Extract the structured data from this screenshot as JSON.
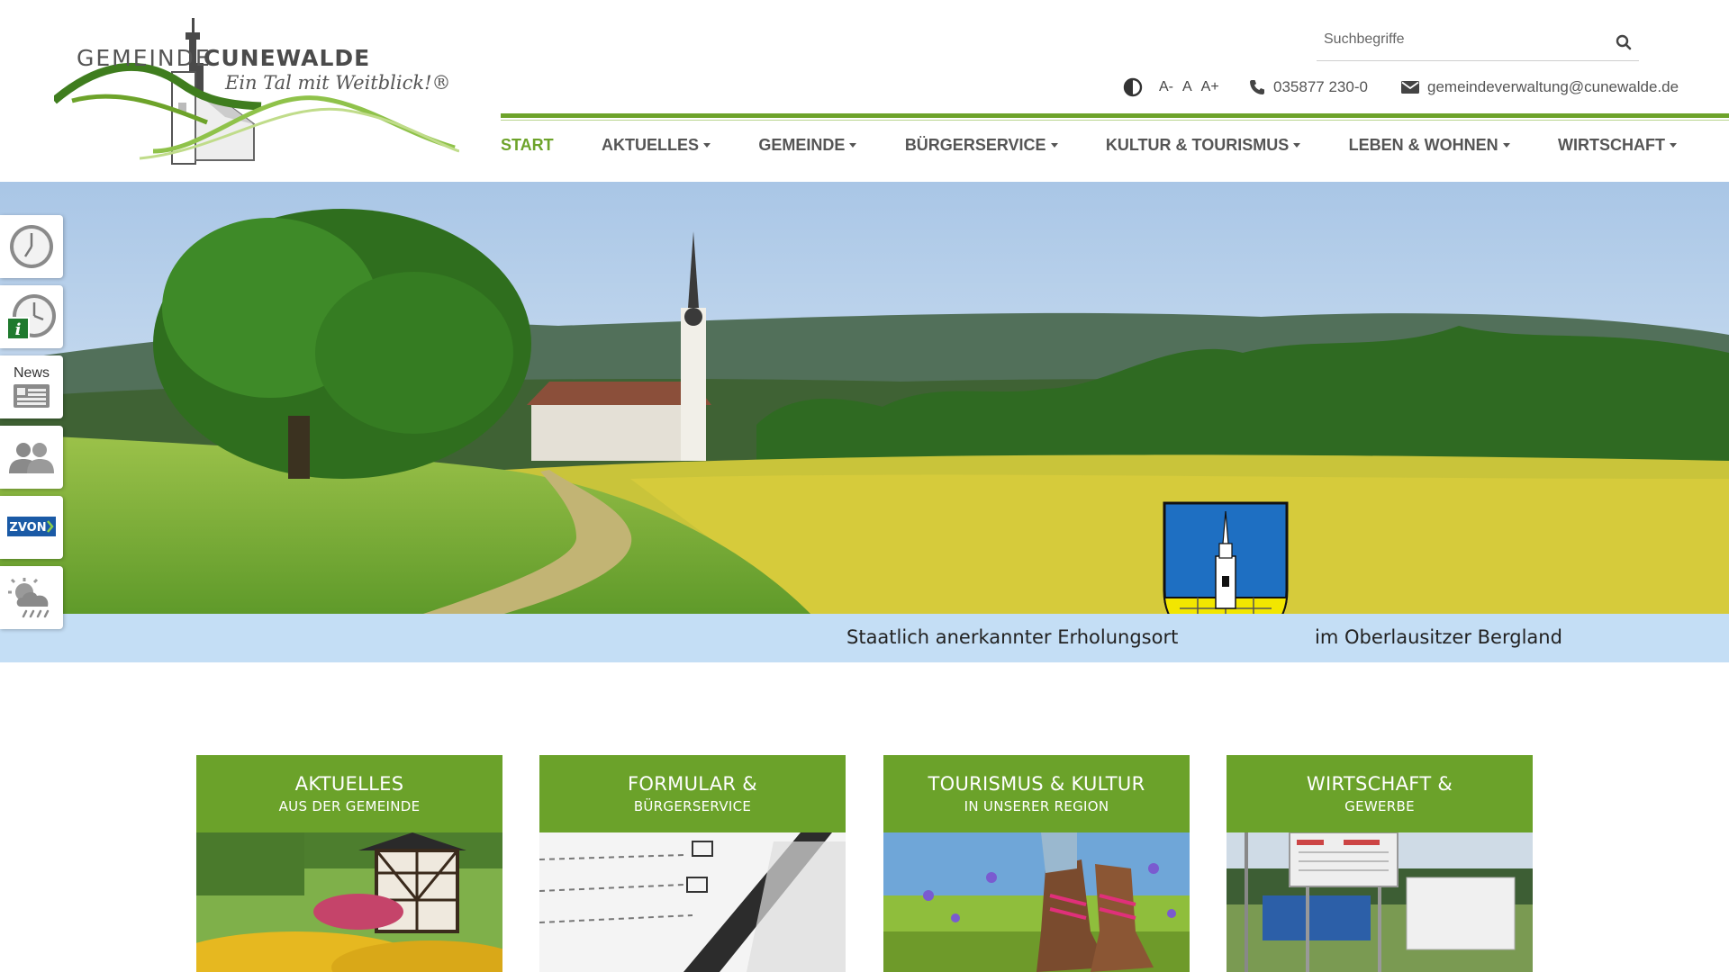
{
  "logo": {
    "name_part1": "GEMEINDE",
    "name_part2": "CUNEWALDE",
    "slogan": "Ein Tal mit Weitblick!®"
  },
  "search": {
    "placeholder": "Suchbegriffe",
    "icon": "search-icon"
  },
  "utility": {
    "contrast_icon": "contrast-icon",
    "font_smaller": "A-",
    "font_normal": "A",
    "font_larger": "A+",
    "phone_icon": "phone-icon",
    "phone": "035877 230-0",
    "mail_icon": "envelope-icon",
    "email": "gemeindeverwaltung@cunewalde.de"
  },
  "nav": {
    "items": [
      {
        "label": "START",
        "active": true,
        "dropdown": false
      },
      {
        "label": "AKTUELLES",
        "active": false,
        "dropdown": true
      },
      {
        "label": "GEMEINDE",
        "active": false,
        "dropdown": true
      },
      {
        "label": "BÜRGERSERVICE",
        "active": false,
        "dropdown": true
      },
      {
        "label": "KULTUR & TOURISMUS",
        "active": false,
        "dropdown": true
      },
      {
        "label": "LEBEN & WOHNEN",
        "active": false,
        "dropdown": true
      },
      {
        "label": "WIRTSCHAFT",
        "active": false,
        "dropdown": true
      }
    ]
  },
  "side_tabs": {
    "news_label": "News",
    "zvon_label": "ZVON",
    "icons": [
      "clock-icon",
      "clock-info-icon",
      "news-icon",
      "people-icon",
      "zvon-logo",
      "weather-icon"
    ]
  },
  "banner": {
    "left_text": "Staatlich anerkannter Erholungsort",
    "right_text": "im Oberlausitzer Bergland"
  },
  "tiles": [
    {
      "title": "AKTUELLES",
      "subtitle": "AUS DER GEMEINDE"
    },
    {
      "title": "FORMULAR &",
      "subtitle": "BÜRGERSERVICE"
    },
    {
      "title": "TOURISMUS & KULTUR",
      "subtitle": "IN UNSERER REGION"
    },
    {
      "title": "WIRTSCHAFT &",
      "subtitle": "GEWERBE"
    }
  ],
  "colors": {
    "brand_green": "#6da32a",
    "banner_blue": "#c4def5",
    "crest_blue": "#1e6fc2",
    "crest_yellow": "#f2e600"
  }
}
